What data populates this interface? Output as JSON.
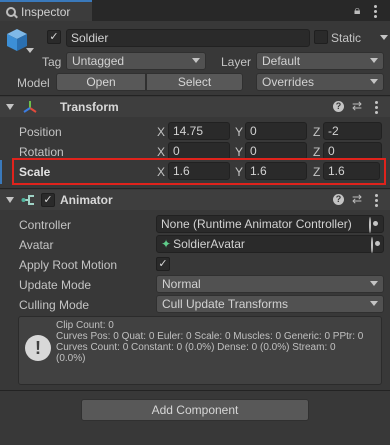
{
  "tab": {
    "label": "Inspector"
  },
  "gameobject": {
    "active_checked": "✓",
    "name": "Soldier",
    "static_label": "Static",
    "tag_label": "Tag",
    "tag_value": "Untagged",
    "layer_label": "Layer",
    "layer_value": "Default",
    "model_label": "Model",
    "open_label": "Open",
    "select_label": "Select",
    "overrides_label": "Overrides"
  },
  "transform": {
    "title": "Transform",
    "position_label": "Position",
    "rotation_label": "Rotation",
    "scale_label": "Scale",
    "x_label": "X",
    "y_label": "Y",
    "z_label": "Z",
    "position": {
      "x": "14.75",
      "y": "0",
      "z": "-2"
    },
    "rotation": {
      "x": "0",
      "y": "0",
      "z": "0"
    },
    "scale": {
      "x": "1.6",
      "y": "1.6",
      "z": "1.6"
    }
  },
  "animator": {
    "title": "Animator",
    "enabled_checked": "✓",
    "controller_label": "Controller",
    "controller_value": "None (Runtime Animator Controller)",
    "avatar_label": "Avatar",
    "avatar_value": "SoldierAvatar",
    "apply_root_motion_label": "Apply Root Motion",
    "apply_root_motion_checked": "✓",
    "update_mode_label": "Update Mode",
    "update_mode_value": "Normal",
    "culling_mode_label": "Culling Mode",
    "culling_mode_value": "Cull Update Transforms",
    "info_lines": [
      "Clip Count: 0",
      "Curves Pos: 0 Quat: 0 Euler: 0 Scale: 0 Muscles: 0 Generic: 0 PPtr: 0",
      "Curves Count: 0 Constant: 0 (0.0%) Dense: 0 (0.0%) Stream: 0",
      "(0.0%)"
    ]
  },
  "add_component_label": "Add Component",
  "colors": {
    "highlight": "#e0231c",
    "accent": "#3a79bb"
  }
}
